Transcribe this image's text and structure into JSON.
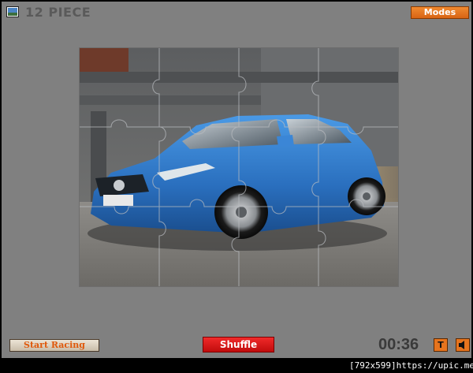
{
  "header": {
    "title": "12 PIECE",
    "modes_label": "Modes",
    "picture_icon": "picture-icon"
  },
  "board": {
    "pieces_total": 12,
    "grid": {
      "columns": 4,
      "rows": 3
    },
    "image_subject": "blue hatchback car in concrete garage"
  },
  "footer": {
    "start_label": "Start Racing",
    "shuffle_label": "Shuffle",
    "timer": "00:36",
    "t_label": "T",
    "sound_icon": "speaker-icon"
  },
  "watermark": "[792x599]https://upic.me/",
  "colors": {
    "frame": "#808080",
    "modes_button": "#e6741e",
    "shuffle_button": "#e01818",
    "start_text": "#e0590c",
    "car_body": "#2f7ccf"
  }
}
